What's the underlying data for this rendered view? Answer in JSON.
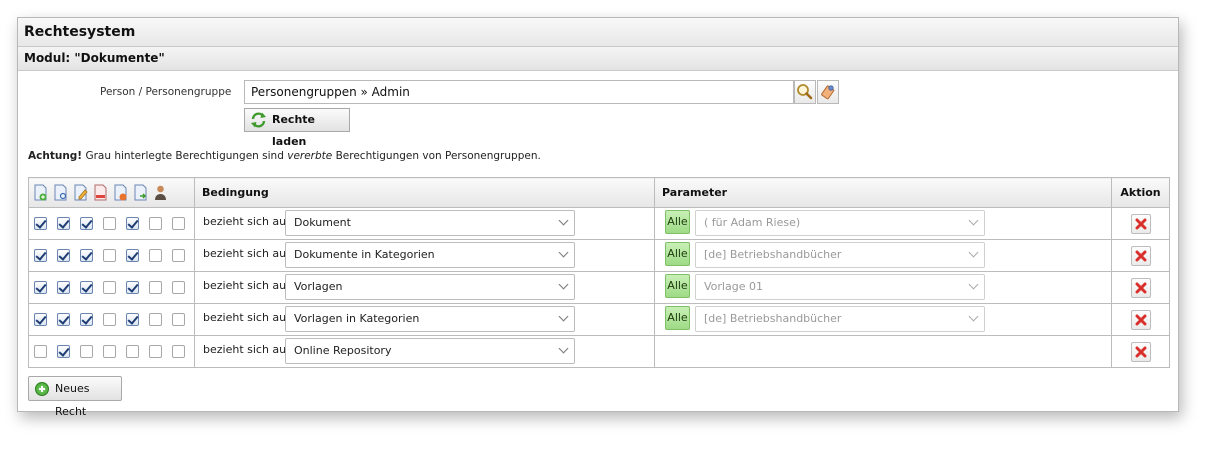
{
  "window": {
    "title": "Rechtesystem",
    "module_title": "Modul: \"Dokumente\""
  },
  "person": {
    "label": "Person / Personengruppe",
    "value": "Personengruppen » Admin",
    "search_icon": "magnifier-icon",
    "clear_icon": "eraser-icon"
  },
  "load_button": {
    "label": "Rechte laden",
    "icon": "refresh-icon"
  },
  "notice": {
    "bold": "Achtung!",
    "text1": "Grau hinterlegte Berechtigungen sind",
    "italic": "vererbte",
    "text2": "Berechtigungen von Personengruppen."
  },
  "table": {
    "header_icons": [
      "document-add-icon",
      "document-view-icon",
      "document-edit-icon",
      "document-delete-icon",
      "document-remove-icon",
      "document-export-icon",
      "user-icon"
    ],
    "col_condition": "Bedingung",
    "col_parameter": "Parameter",
    "col_action": "Aktion",
    "rows": [
      {
        "checks": [
          true,
          true,
          true,
          false,
          true,
          false,
          false
        ],
        "relation": "bezieht sich auf",
        "condition": "Dokument",
        "has_param": true,
        "alle": "Alle",
        "parameter": "( für Adam Riese)"
      },
      {
        "checks": [
          true,
          true,
          true,
          false,
          true,
          false,
          false
        ],
        "relation": "bezieht sich auf",
        "condition": "Dokumente in Kategorien",
        "has_param": true,
        "alle": "Alle",
        "parameter": "[de] Betriebshandbücher"
      },
      {
        "checks": [
          true,
          true,
          true,
          false,
          true,
          false,
          false
        ],
        "relation": "bezieht sich auf",
        "condition": "Vorlagen",
        "has_param": true,
        "alle": "Alle",
        "parameter": "Vorlage 01"
      },
      {
        "checks": [
          true,
          true,
          true,
          false,
          true,
          false,
          false
        ],
        "relation": "bezieht sich auf",
        "condition": "Vorlagen in Kategorien",
        "has_param": true,
        "alle": "Alle",
        "parameter": "[de] Betriebshandbücher"
      },
      {
        "checks": [
          false,
          true,
          false,
          false,
          false,
          false,
          false
        ],
        "relation": "bezieht sich auf",
        "condition": "Online Repository",
        "has_param": false,
        "alle": "",
        "parameter": ""
      }
    ]
  },
  "new_button": {
    "label": "Neues Recht",
    "icon": "plus-circle-icon"
  },
  "colors": {
    "alle_green": "#9edb85",
    "delete_red": "#d9302c",
    "header_bg": "#e6e6e6"
  }
}
